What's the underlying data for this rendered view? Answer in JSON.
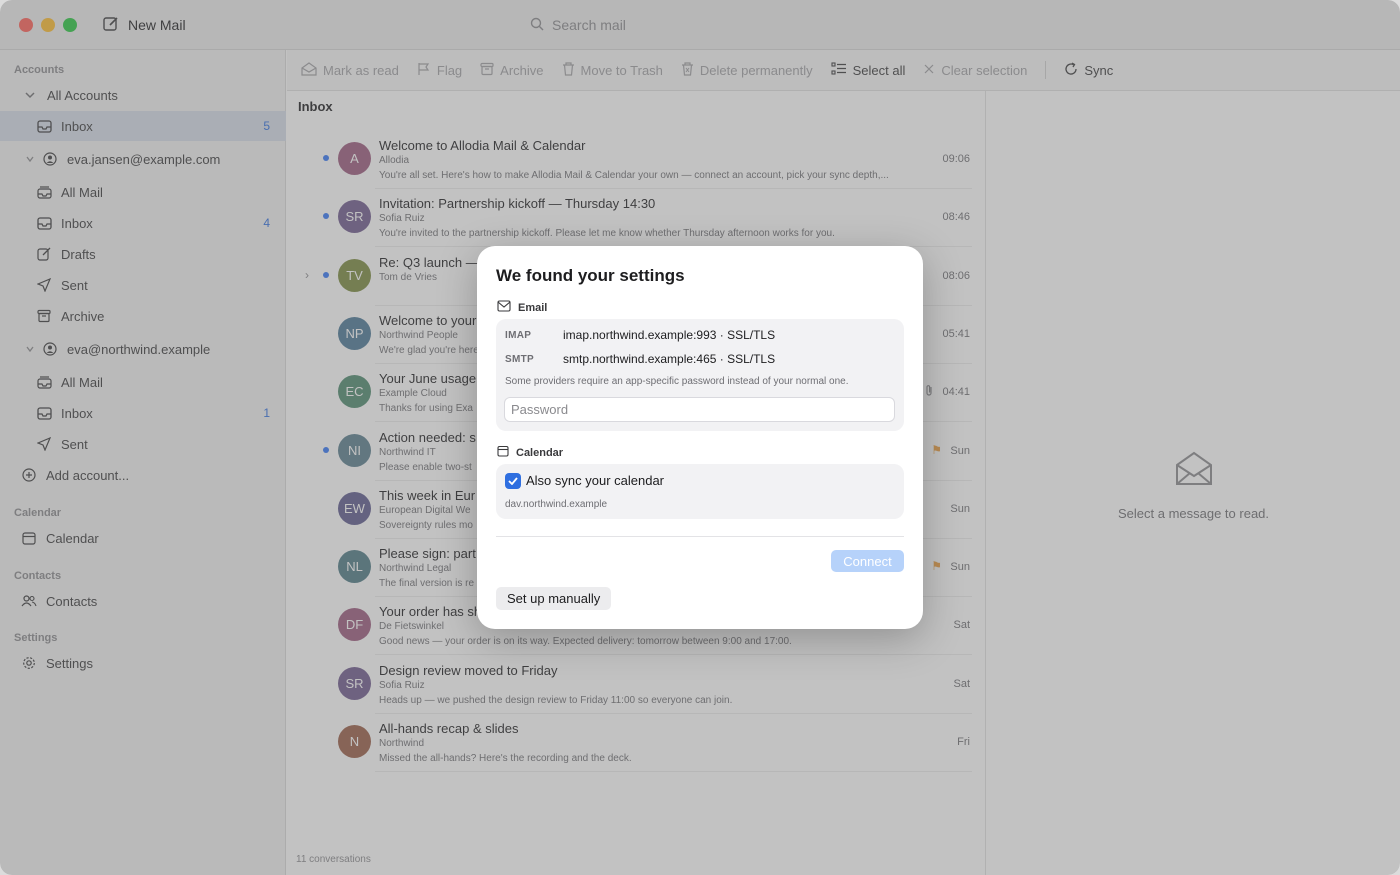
{
  "titlebar": {
    "new_mail_label": "New Mail",
    "search_placeholder": "Search mail"
  },
  "sidebar": {
    "sections": {
      "accounts": "Accounts",
      "calendar": "Calendar",
      "contacts": "Contacts",
      "settings": "Settings"
    },
    "all_accounts": "All Accounts",
    "inbox_all": {
      "label": "Inbox",
      "count": "5"
    },
    "account1": "eva.jansen@example.com",
    "a1_all_mail": "All Mail",
    "a1_inbox": {
      "label": "Inbox",
      "count": "4"
    },
    "a1_drafts": "Drafts",
    "a1_sent": "Sent",
    "a1_archive": "Archive",
    "account2": "eva@northwind.example",
    "a2_all_mail": "All Mail",
    "a2_inbox": {
      "label": "Inbox",
      "count": "1"
    },
    "a2_sent": "Sent",
    "add_account": "Add account...",
    "calendar_item": "Calendar",
    "contacts_item": "Contacts",
    "settings_item": "Settings"
  },
  "toolbar": {
    "mark_read": "Mark as read",
    "flag": "Flag",
    "archive": "Archive",
    "move_trash": "Move to Trash",
    "delete_perm": "Delete permanently",
    "select_all": "Select all",
    "clear_sel": "Clear selection",
    "sync": "Sync"
  },
  "list": {
    "title": "Inbox",
    "footer": "11 conversations",
    "messages": [
      {
        "initials": "A",
        "color": "#9c5b7f",
        "subject": "Welcome to Allodia Mail & Calendar",
        "sender": "Allodia",
        "preview": "You're all set. Here's how to make Allodia Mail & Calendar your own — connect an account, pick your sync depth,...",
        "time": "09:06",
        "unread": true
      },
      {
        "initials": "SR",
        "color": "#6f5a8e",
        "subject": "Invitation: Partnership kickoff — Thursday 14:30",
        "sender": "Sofia Ruiz",
        "preview": "You're invited to the partnership kickoff. Please let me know whether Thursday afternoon works for you.",
        "time": "08:46",
        "unread": true
      },
      {
        "initials": "TV",
        "color": "#7a8a3e",
        "subject": "Re: Q3 launch —",
        "sender": "Tom de Vries",
        "preview": "",
        "time": "08:06",
        "unread": true,
        "thread": true
      },
      {
        "initials": "NP",
        "color": "#4a7896",
        "subject": "Welcome to your",
        "sender": "Northwind People",
        "preview": "We're glad you're here",
        "time": "05:41"
      },
      {
        "initials": "EC",
        "color": "#4f8a6e",
        "subject": "Your June usage",
        "sender": "Example Cloud",
        "preview": "Thanks for using Exa",
        "time": "04:41",
        "attachment": true
      },
      {
        "initials": "NI",
        "color": "#5a7e8e",
        "subject": "Action needed: s",
        "sender": "Northwind IT",
        "preview": "Please enable two-st",
        "time": "Sun",
        "unread": true,
        "flagged": true
      },
      {
        "initials": "EW",
        "color": "#5d5a8e",
        "subject": "This week in Eur",
        "sender": "European Digital We",
        "preview": "Sovereignty rules mo",
        "time": "Sun"
      },
      {
        "initials": "NL",
        "color": "#4e7a86",
        "subject": "Please sign: part",
        "sender": "Northwind Legal",
        "preview": "The final version is re",
        "time": "Sun",
        "flagged": true
      },
      {
        "initials": "DF",
        "color": "#9c5b7f",
        "subject": "Your order has sh",
        "sender": "De Fietswinkel",
        "preview": "Good news — your order is on its way. Expected delivery: tomorrow between 9:00 and 17:00.",
        "time": "Sat"
      },
      {
        "initials": "SR",
        "color": "#6f5a8e",
        "subject": "Design review moved to Friday",
        "sender": "Sofia Ruiz",
        "preview": "Heads up — we pushed the design review to Friday 11:00 so everyone can join.",
        "time": "Sat"
      },
      {
        "initials": "N",
        "color": "#9a5e48",
        "subject": "All-hands recap & slides",
        "sender": "Northwind",
        "preview": "Missed the all-hands? Here's the recording and the deck.",
        "time": "Fri"
      }
    ]
  },
  "reader": {
    "empty_text": "Select a message to read."
  },
  "modal": {
    "title": "We found your settings",
    "email_section": "Email",
    "imap_label": "IMAP",
    "imap_value": "imap.northwind.example:993 · SSL/TLS",
    "smtp_label": "SMTP",
    "smtp_value": "smtp.northwind.example:465 · SSL/TLS",
    "hint": "Some providers require an app-specific password instead of your normal one.",
    "password_placeholder": "Password",
    "calendar_section": "Calendar",
    "calendar_checkbox": "Also sync your calendar",
    "calendar_checked": true,
    "dav_host": "dav.northwind.example",
    "connect": "Connect",
    "setup_manually": "Set up manually"
  }
}
